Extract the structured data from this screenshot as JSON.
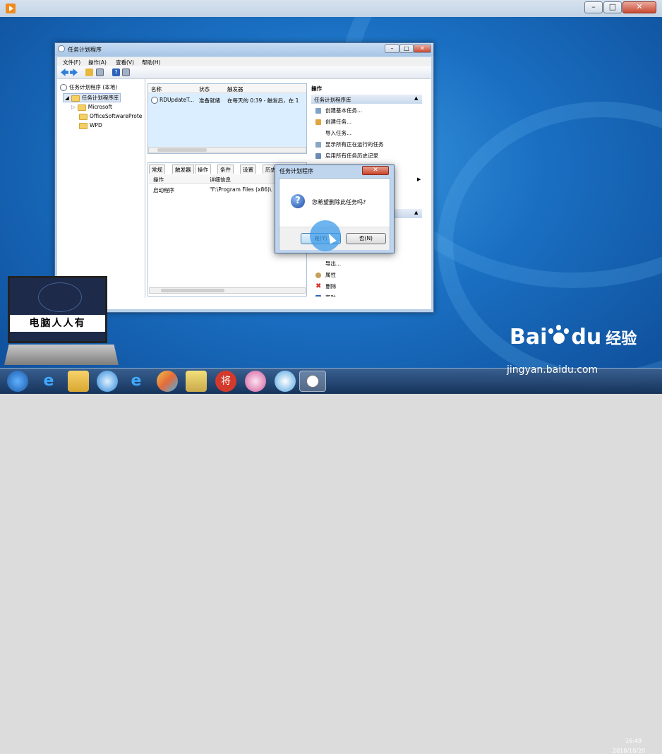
{
  "task_scheduler": {
    "title": "任务计划程序",
    "menu": [
      "文件(F)",
      "操作(A)",
      "查看(V)",
      "帮助(H)"
    ],
    "tree": {
      "root": "任务计划程序 (本地)",
      "library": "任务计划程序库",
      "folders": [
        "Microsoft",
        "OfficeSoftwareProte",
        "WPD"
      ]
    },
    "task_list": {
      "columns": [
        "名称",
        "状态",
        "触发器"
      ],
      "rows": [
        {
          "name": "RDUpdateT...",
          "status": "准备就绪",
          "trigger": "在每天的 0:39 - 触发后，在 1"
        }
      ]
    },
    "details": {
      "tabs": [
        "常规",
        "触发器",
        "操作",
        "条件",
        "设置",
        "历史"
      ],
      "active_tab": "操作",
      "columns": [
        "操作",
        "详细信息"
      ],
      "rows": [
        {
          "action": "启动程序",
          "detail": "\"F:\\Program Files (x86)\\"
        }
      ]
    },
    "actions_pane": {
      "header": "操作",
      "section_title": "任务计划程序库",
      "items": [
        "创建基本任务...",
        "创建任务...",
        "导入任务...",
        "显示所有正在运行的任务",
        "启用所有任务历史记录"
      ],
      "selected_items": [
        "导出...",
        "属性",
        "删除",
        "帮助"
      ]
    }
  },
  "dialog": {
    "title": "任务计划程序",
    "message": "您希望删除此任务吗?",
    "yes_button": "是(Y)",
    "no_button": "否(N)",
    "close_symbol": "✕"
  },
  "logo": {
    "label": "电脑人人有"
  },
  "watermark": {
    "brand": "Bai",
    "brand2": "du",
    "suffix": "经验",
    "url": "jingyan.baidu.com"
  },
  "taskbar": {
    "clock_time": "16:49",
    "clock_date": "2018/10/20"
  },
  "colors": {
    "desktop": "#1a6fc2",
    "selection": "#dbeeff",
    "dialog_highlight": "#3d9be9"
  }
}
